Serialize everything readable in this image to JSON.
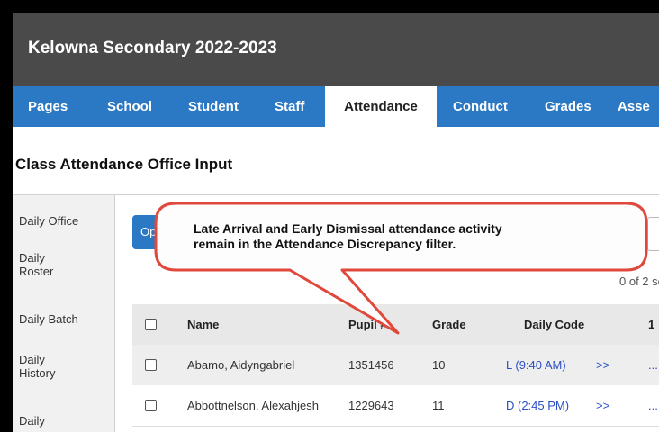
{
  "app": {
    "title": "Kelowna Secondary 2022-2023"
  },
  "nav": {
    "tabs": [
      {
        "label": "Pages"
      },
      {
        "label": "School"
      },
      {
        "label": "Student"
      },
      {
        "label": "Staff"
      },
      {
        "label": "Attendance",
        "active": true
      },
      {
        "label": "Conduct"
      },
      {
        "label": "Grades"
      },
      {
        "label": "Asse"
      }
    ]
  },
  "page": {
    "title": "Class Attendance Office Input"
  },
  "sidebar": {
    "items": [
      {
        "label": "Daily Office"
      },
      {
        "label": "Daily Roster"
      },
      {
        "label": "Daily Batch"
      },
      {
        "label": "Daily History"
      },
      {
        "label": "Daily"
      }
    ]
  },
  "toolbar": {
    "options_label": "Op"
  },
  "selection": {
    "count_text": "0 of 2 se"
  },
  "table": {
    "headers": {
      "name": "Name",
      "pupil": "Pupil #",
      "grade": "Grade",
      "daily_code": "Daily Code",
      "period1": "1"
    },
    "rows": [
      {
        "name": "Abamo, Aidyngabriel",
        "pupil": "1351456",
        "grade": "10",
        "code": "L (9:40 AM)",
        "more": ">>",
        "period": "..."
      },
      {
        "name": "Abbottnelson, Alexahjesh",
        "pupil": "1229643",
        "grade": "11",
        "code": "D (2:45 PM)",
        "more": ">>",
        "period": "..."
      }
    ]
  },
  "callout": {
    "line1": "Late Arrival and Early Dismissal attendance activity",
    "line2": "remain in the Attendance Discrepancy filter.",
    "border_color": "#e0483b"
  }
}
